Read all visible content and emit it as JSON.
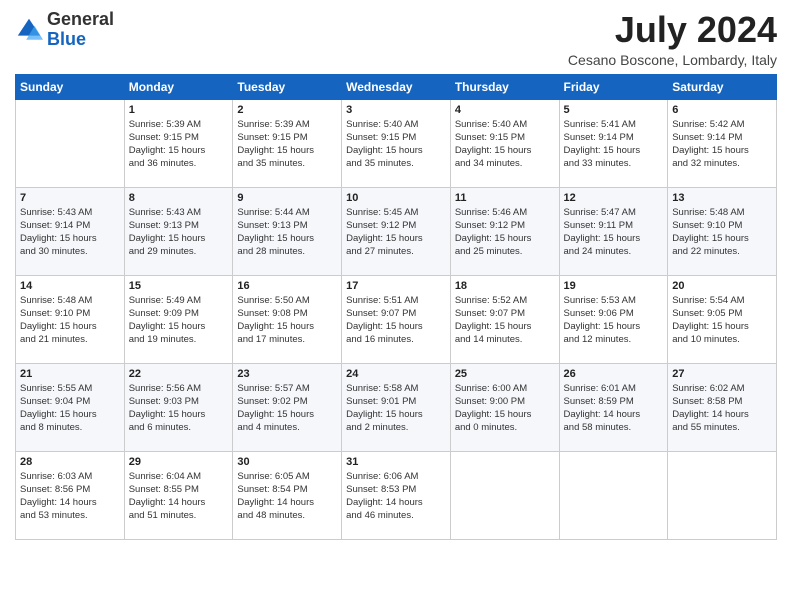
{
  "header": {
    "logo_general": "General",
    "logo_blue": "Blue",
    "month_year": "July 2024",
    "location": "Cesano Boscone, Lombardy, Italy"
  },
  "days_of_week": [
    "Sunday",
    "Monday",
    "Tuesday",
    "Wednesday",
    "Thursday",
    "Friday",
    "Saturday"
  ],
  "weeks": [
    [
      {
        "day": "",
        "info": ""
      },
      {
        "day": "1",
        "info": "Sunrise: 5:39 AM\nSunset: 9:15 PM\nDaylight: 15 hours\nand 36 minutes."
      },
      {
        "day": "2",
        "info": "Sunrise: 5:39 AM\nSunset: 9:15 PM\nDaylight: 15 hours\nand 35 minutes."
      },
      {
        "day": "3",
        "info": "Sunrise: 5:40 AM\nSunset: 9:15 PM\nDaylight: 15 hours\nand 35 minutes."
      },
      {
        "day": "4",
        "info": "Sunrise: 5:40 AM\nSunset: 9:15 PM\nDaylight: 15 hours\nand 34 minutes."
      },
      {
        "day": "5",
        "info": "Sunrise: 5:41 AM\nSunset: 9:14 PM\nDaylight: 15 hours\nand 33 minutes."
      },
      {
        "day": "6",
        "info": "Sunrise: 5:42 AM\nSunset: 9:14 PM\nDaylight: 15 hours\nand 32 minutes."
      }
    ],
    [
      {
        "day": "7",
        "info": "Sunrise: 5:43 AM\nSunset: 9:14 PM\nDaylight: 15 hours\nand 30 minutes."
      },
      {
        "day": "8",
        "info": "Sunrise: 5:43 AM\nSunset: 9:13 PM\nDaylight: 15 hours\nand 29 minutes."
      },
      {
        "day": "9",
        "info": "Sunrise: 5:44 AM\nSunset: 9:13 PM\nDaylight: 15 hours\nand 28 minutes."
      },
      {
        "day": "10",
        "info": "Sunrise: 5:45 AM\nSunset: 9:12 PM\nDaylight: 15 hours\nand 27 minutes."
      },
      {
        "day": "11",
        "info": "Sunrise: 5:46 AM\nSunset: 9:12 PM\nDaylight: 15 hours\nand 25 minutes."
      },
      {
        "day": "12",
        "info": "Sunrise: 5:47 AM\nSunset: 9:11 PM\nDaylight: 15 hours\nand 24 minutes."
      },
      {
        "day": "13",
        "info": "Sunrise: 5:48 AM\nSunset: 9:10 PM\nDaylight: 15 hours\nand 22 minutes."
      }
    ],
    [
      {
        "day": "14",
        "info": "Sunrise: 5:48 AM\nSunset: 9:10 PM\nDaylight: 15 hours\nand 21 minutes."
      },
      {
        "day": "15",
        "info": "Sunrise: 5:49 AM\nSunset: 9:09 PM\nDaylight: 15 hours\nand 19 minutes."
      },
      {
        "day": "16",
        "info": "Sunrise: 5:50 AM\nSunset: 9:08 PM\nDaylight: 15 hours\nand 17 minutes."
      },
      {
        "day": "17",
        "info": "Sunrise: 5:51 AM\nSunset: 9:07 PM\nDaylight: 15 hours\nand 16 minutes."
      },
      {
        "day": "18",
        "info": "Sunrise: 5:52 AM\nSunset: 9:07 PM\nDaylight: 15 hours\nand 14 minutes."
      },
      {
        "day": "19",
        "info": "Sunrise: 5:53 AM\nSunset: 9:06 PM\nDaylight: 15 hours\nand 12 minutes."
      },
      {
        "day": "20",
        "info": "Sunrise: 5:54 AM\nSunset: 9:05 PM\nDaylight: 15 hours\nand 10 minutes."
      }
    ],
    [
      {
        "day": "21",
        "info": "Sunrise: 5:55 AM\nSunset: 9:04 PM\nDaylight: 15 hours\nand 8 minutes."
      },
      {
        "day": "22",
        "info": "Sunrise: 5:56 AM\nSunset: 9:03 PM\nDaylight: 15 hours\nand 6 minutes."
      },
      {
        "day": "23",
        "info": "Sunrise: 5:57 AM\nSunset: 9:02 PM\nDaylight: 15 hours\nand 4 minutes."
      },
      {
        "day": "24",
        "info": "Sunrise: 5:58 AM\nSunset: 9:01 PM\nDaylight: 15 hours\nand 2 minutes."
      },
      {
        "day": "25",
        "info": "Sunrise: 6:00 AM\nSunset: 9:00 PM\nDaylight: 15 hours\nand 0 minutes."
      },
      {
        "day": "26",
        "info": "Sunrise: 6:01 AM\nSunset: 8:59 PM\nDaylight: 14 hours\nand 58 minutes."
      },
      {
        "day": "27",
        "info": "Sunrise: 6:02 AM\nSunset: 8:58 PM\nDaylight: 14 hours\nand 55 minutes."
      }
    ],
    [
      {
        "day": "28",
        "info": "Sunrise: 6:03 AM\nSunset: 8:56 PM\nDaylight: 14 hours\nand 53 minutes."
      },
      {
        "day": "29",
        "info": "Sunrise: 6:04 AM\nSunset: 8:55 PM\nDaylight: 14 hours\nand 51 minutes."
      },
      {
        "day": "30",
        "info": "Sunrise: 6:05 AM\nSunset: 8:54 PM\nDaylight: 14 hours\nand 48 minutes."
      },
      {
        "day": "31",
        "info": "Sunrise: 6:06 AM\nSunset: 8:53 PM\nDaylight: 14 hours\nand 46 minutes."
      },
      {
        "day": "",
        "info": ""
      },
      {
        "day": "",
        "info": ""
      },
      {
        "day": "",
        "info": ""
      }
    ]
  ]
}
